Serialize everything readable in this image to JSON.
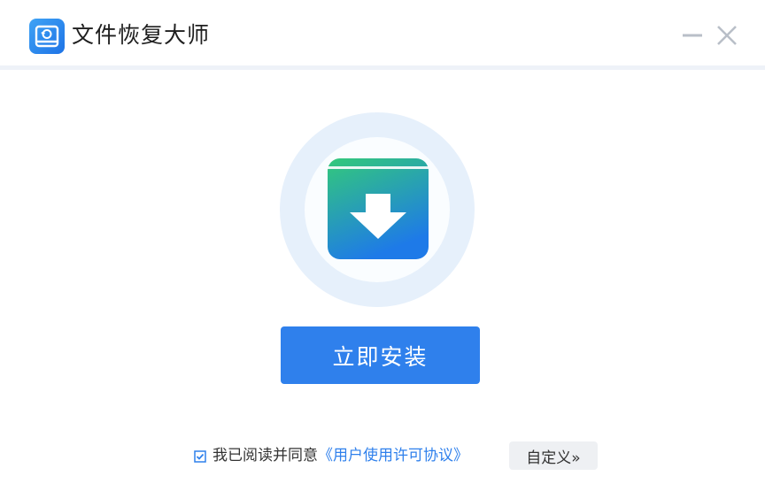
{
  "window": {
    "title": "文件恢复大师"
  },
  "main": {
    "install_label": "立即安装"
  },
  "agreement": {
    "checked": true,
    "prefix": "我已阅读并同意",
    "link_text": "《用户使用许可协议》",
    "custom_label": "自定义»"
  },
  "icons": {
    "app": "recovery-drive-icon",
    "minimize": "minimize-icon",
    "close": "close-icon",
    "hero": "download-box-icon",
    "checkbox": "checkbox-checked-icon"
  },
  "colors": {
    "accent": "#2f80ec",
    "ring": "#e6f0fb",
    "box_top": "#33c97a",
    "box_bottom": "#1e7ae8"
  }
}
